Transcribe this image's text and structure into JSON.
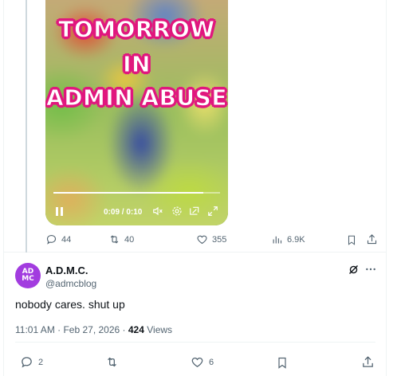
{
  "video": {
    "overlay_lines": [
      "TOMORROW",
      "IN",
      "ADMIN ABUSE"
    ],
    "time": "0:09 / 0:10",
    "progress": 0.9,
    "icons": [
      "pause-icon",
      "mute-icon",
      "settings-icon",
      "pip-icon",
      "fullscreen-icon"
    ]
  },
  "top_actions": {
    "replies": "44",
    "reposts": "40",
    "likes": "355",
    "views": "6.9K"
  },
  "reply": {
    "avatar_text_1": "AD",
    "avatar_text_2": "MC",
    "display_name": "A.D.M.C.",
    "handle": "@admcblog",
    "text": "nobody cares. shut up",
    "timestamp": "11:01 AM · Feb 27, 2026 · ",
    "views_count": "424",
    "views_label": " Views",
    "replies": "2",
    "reposts": "",
    "likes": "6"
  },
  "colors": {
    "accent_pink": "#e0177e",
    "avatar_purple": "#a23cdf",
    "secondary_text": "#536471",
    "primary_text": "#0f1419"
  }
}
